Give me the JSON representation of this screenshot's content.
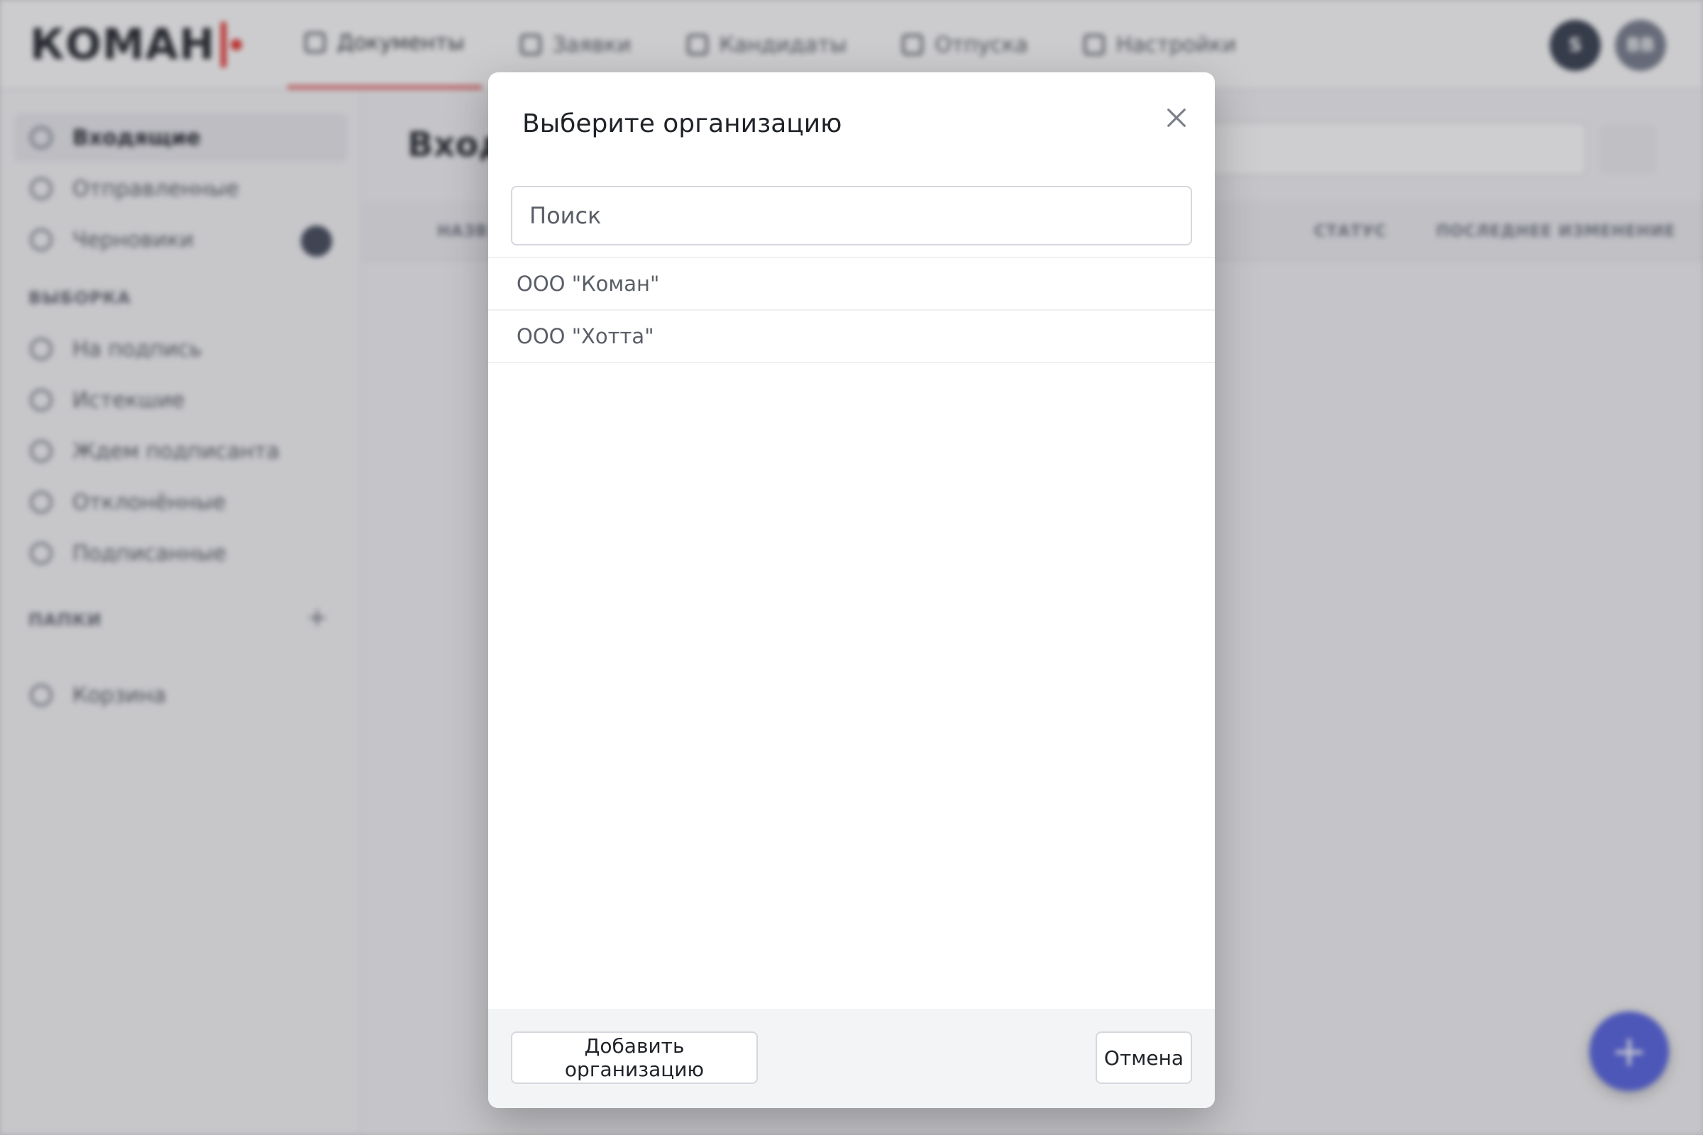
{
  "app": {
    "logo_text": "КОМАН",
    "nav": [
      {
        "label": "Документы",
        "icon": "document-icon"
      },
      {
        "label": "Заявки",
        "icon": "briefcase-icon"
      },
      {
        "label": "Кандидаты",
        "icon": "user-icon"
      },
      {
        "label": "Отпуска",
        "icon": "palm-icon"
      },
      {
        "label": "Настройки",
        "icon": "gear-icon"
      }
    ],
    "avatars": [
      "S",
      "ВВ"
    ],
    "sidebar": {
      "items": [
        {
          "label": "Входящие",
          "active": true
        },
        {
          "label": "Отправленные"
        },
        {
          "label": "Черновики"
        }
      ],
      "section_filter": "ВЫБОРКА",
      "filter_items": [
        {
          "label": "На подпись"
        },
        {
          "label": "Истекшие"
        },
        {
          "label": "Ждем подписанта"
        },
        {
          "label": "Отклонённые"
        },
        {
          "label": "Подписанные"
        }
      ],
      "section_folders": "ПАПКИ",
      "trash_label": "Корзина"
    },
    "main": {
      "title": "Входящие",
      "columns": [
        "НАЗВ",
        "СТАТУС",
        "ПОСЛЕДНЕЕ ИЗМЕНЕНИЕ"
      ]
    }
  },
  "modal": {
    "title": "Выберите организацию",
    "search_placeholder": "Поиск",
    "organizations": [
      "ООО \"Коман\"",
      "ООО \"Хотта\""
    ],
    "add_button": "Добавить организацию",
    "cancel_button": "Отмена"
  }
}
